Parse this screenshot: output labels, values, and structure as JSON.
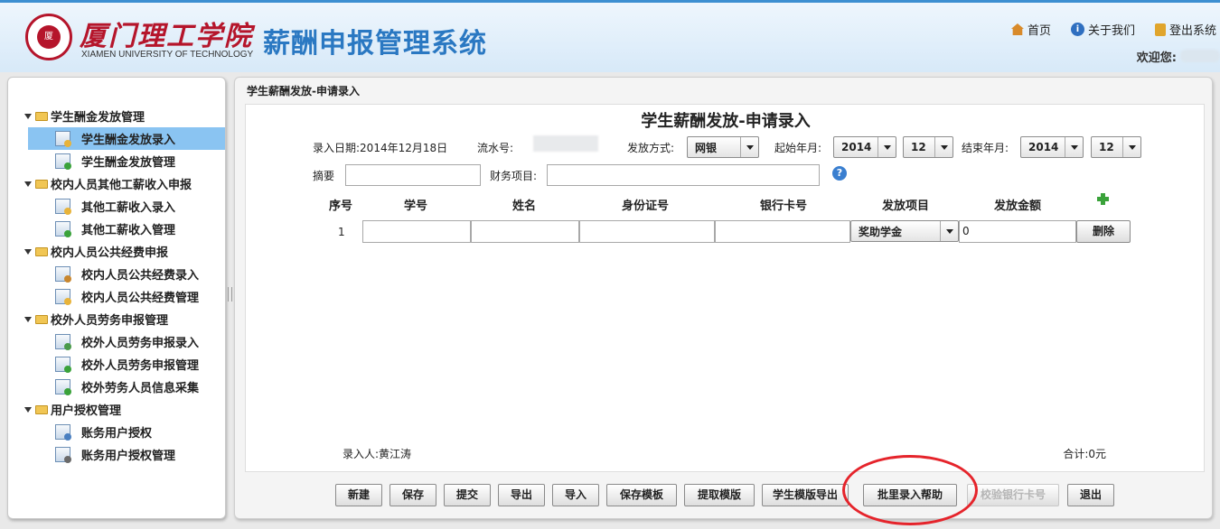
{
  "header": {
    "logo_text": "厦门理工学院",
    "logo_en": "XIAMEN UNIVERSITY OF TECHNOLOGY",
    "system_title": "薪酬申报管理系统",
    "links": {
      "home": "首页",
      "about": "关于我们",
      "logout": "登出系统"
    },
    "welcome": "欢迎您:"
  },
  "sidebar": {
    "groups": [
      {
        "label": "学生酬金发放管理",
        "items": [
          {
            "label": "学生酬金发放录入",
            "icon": "edit-icon"
          },
          {
            "label": "学生酬金发放管理",
            "icon": "manage-icon"
          }
        ]
      },
      {
        "label": "校内人员其他工薪收入申报",
        "items": [
          {
            "label": "其他工薪收入录入",
            "icon": "edit-icon"
          },
          {
            "label": "其他工薪收入管理",
            "icon": "manage-icon"
          }
        ]
      },
      {
        "label": "校内人员公共经费申报",
        "items": [
          {
            "label": "校内人员公共经费录入",
            "icon": "house-icon"
          },
          {
            "label": "校内人员公共经费管理",
            "icon": "edit-icon"
          }
        ]
      },
      {
        "label": "校外人员劳务申报管理",
        "items": [
          {
            "label": "校外人员劳务申报录入",
            "icon": "window-icon"
          },
          {
            "label": "校外人员劳务申报管理",
            "icon": "manage-icon"
          },
          {
            "label": "校外劳务人员信息采集",
            "icon": "play-icon"
          }
        ]
      },
      {
        "label": "用户授权管理",
        "items": [
          {
            "label": "账务用户授权",
            "icon": "book-icon"
          },
          {
            "label": "账务用户授权管理",
            "icon": "user-icon"
          }
        ]
      }
    ]
  },
  "main": {
    "breadcrumb": "学生薪酬发放-申请录入",
    "title": "学生薪酬发放-申请录入",
    "entry_date_label": "录入日期:2014年12月18日",
    "serial_label": "流水号:",
    "pay_method_label": "发放方式:",
    "pay_method_value": "网银",
    "start_label": "起始年月:",
    "start_year": "2014",
    "start_month": "12",
    "end_label": "结束年月:",
    "end_year": "2014",
    "end_month": "12",
    "summary_label": "摘要",
    "finance_label": "财务项目:",
    "columns": [
      "序号",
      "学号",
      "姓名",
      "身份证号",
      "银行卡号",
      "发放项目",
      "发放金额"
    ],
    "row": {
      "index": "1",
      "item": "奖助学金",
      "amount": "0",
      "delete": "删除"
    },
    "entered_by": "录入人:黄江涛",
    "total": "合计:0元"
  },
  "toolbar": {
    "buttons": [
      "新建",
      "保存",
      "提交",
      "导出",
      "导入",
      "保存模板",
      "提取模版",
      "学生模版导出",
      "批里录入帮助",
      "校验银行卡号",
      "退出"
    ]
  },
  "colors": {
    "accent": "#2a78c2",
    "selected": "#8ac4f2",
    "annotation": "#e5242b"
  }
}
